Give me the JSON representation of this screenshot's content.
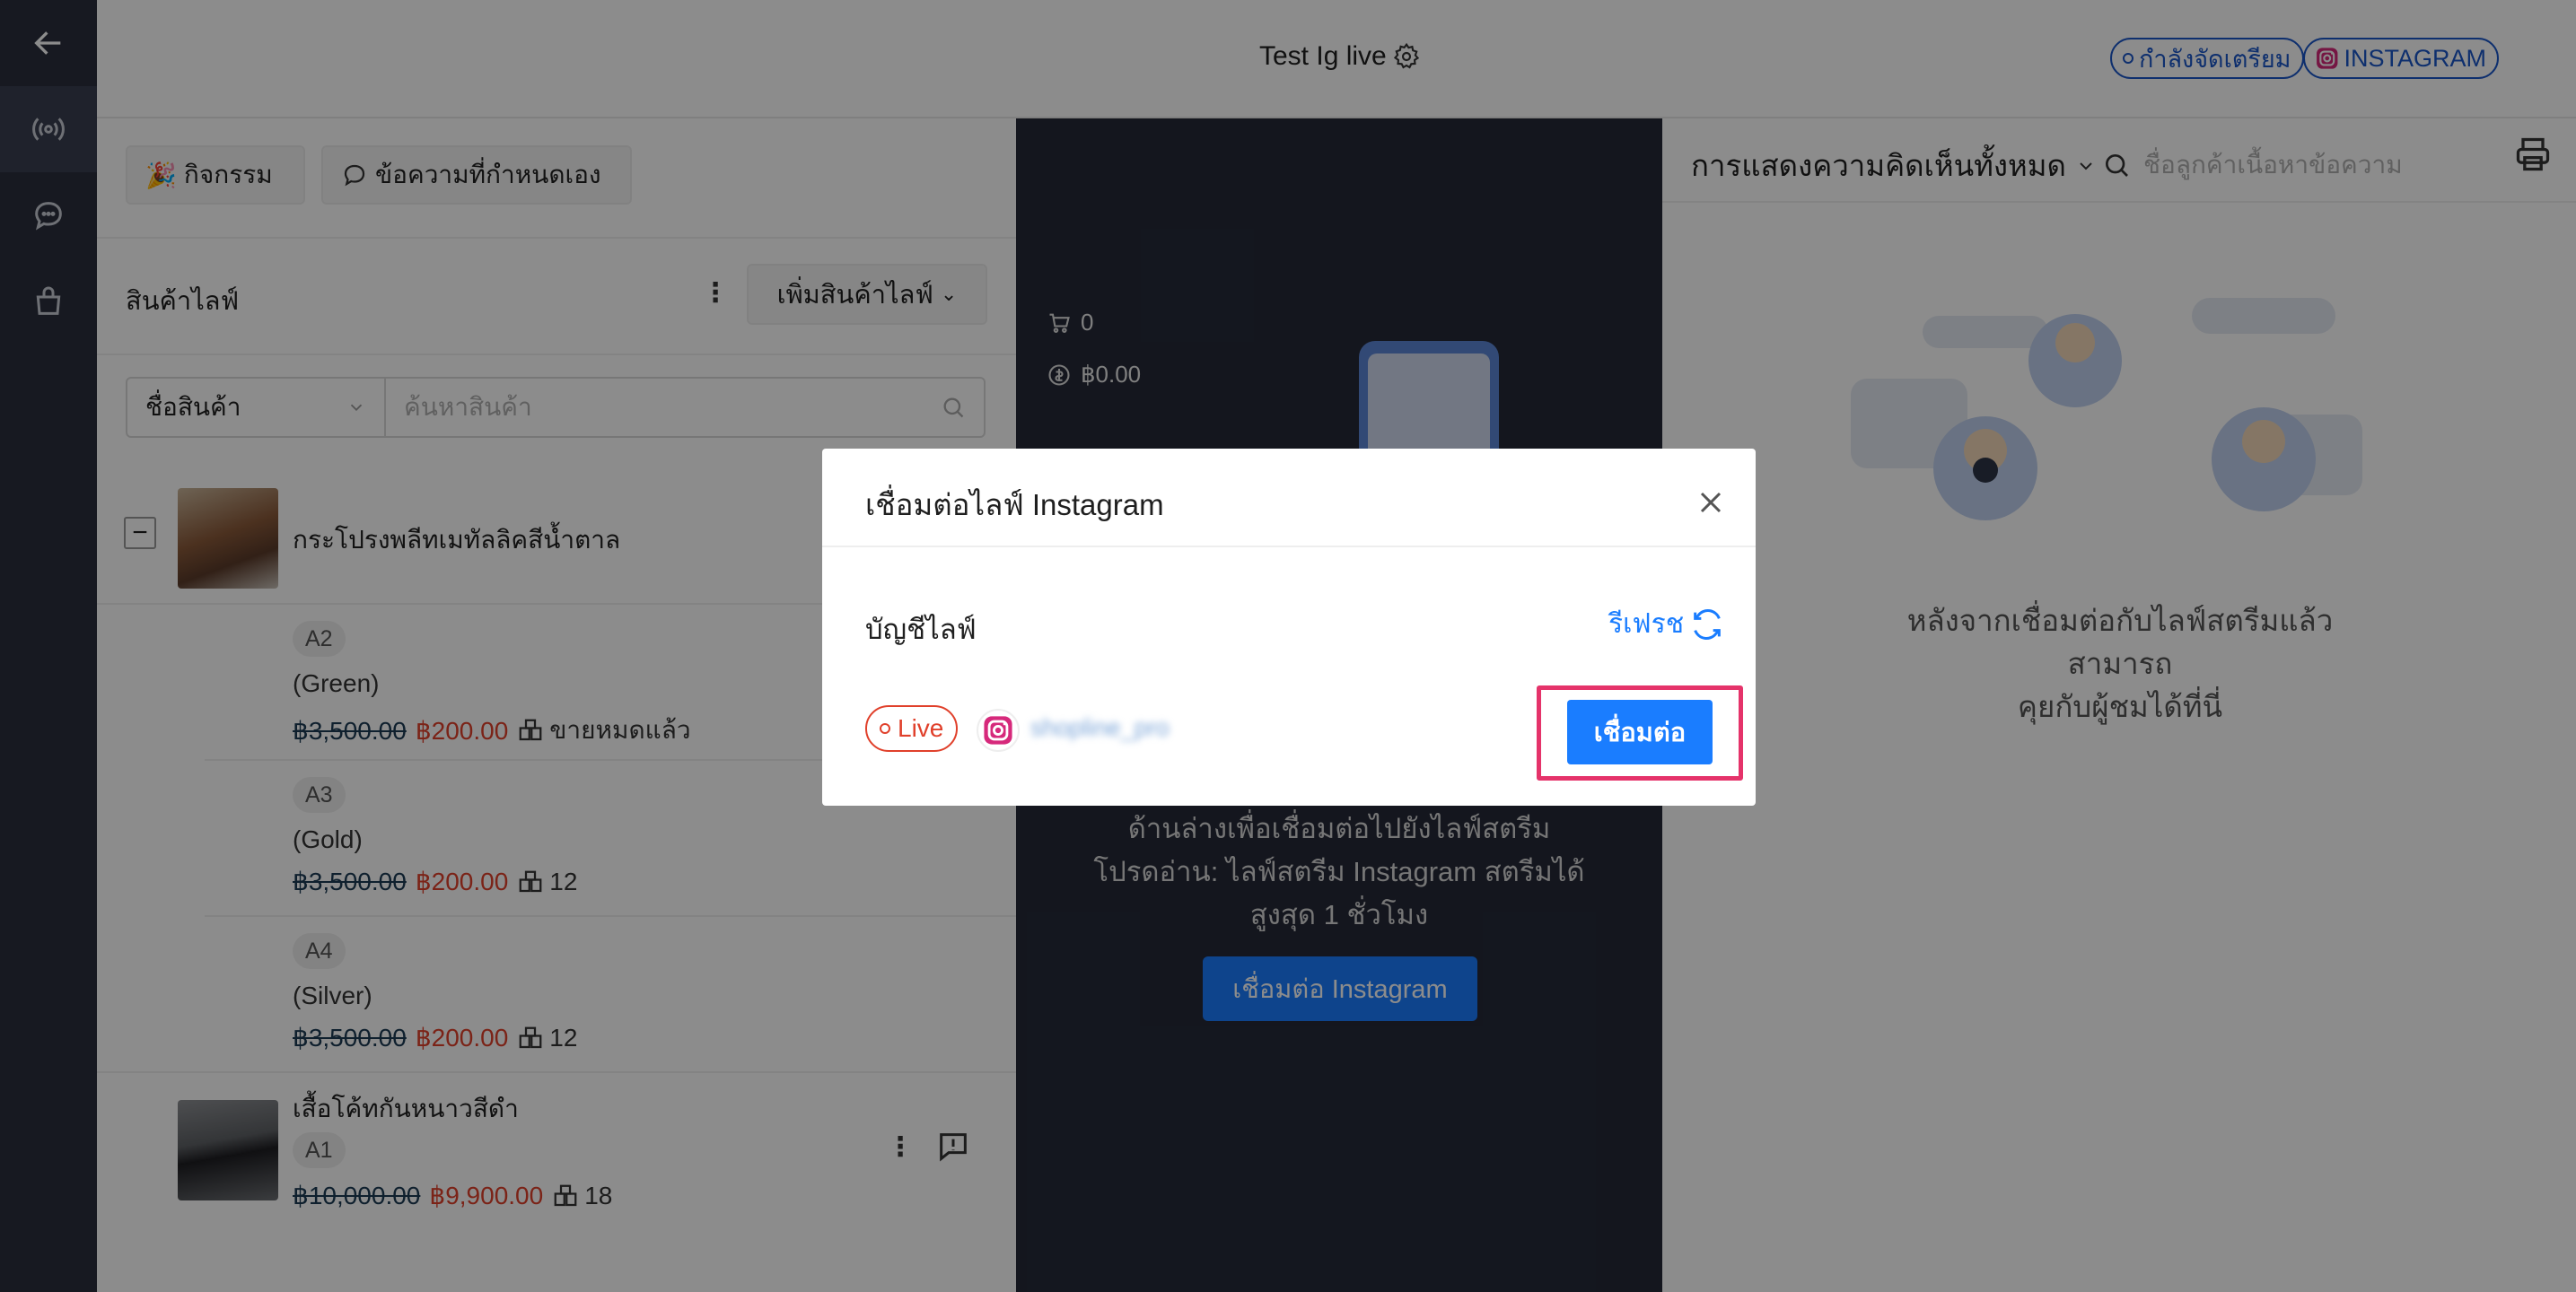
{
  "header": {
    "title": "Test Ig live",
    "status_badge": "กำลังจัดเตรียม",
    "platform_badge": "INSTAGRAM"
  },
  "left_panel": {
    "tabs": [
      "กิจกรรม",
      "ข้อความที่กำหนดเอง"
    ],
    "section_title": "สินค้าไลฟ์",
    "add_button": "เพิ่มสินค้าไลฟ์",
    "search": {
      "select_value": "ชื่อสินค้า",
      "placeholder": "ค้นหาสินค้า"
    },
    "products": [
      {
        "name": "กระโปรงพลีทเมทัลลิคสีน้ำตาล",
        "variants": [
          {
            "sku": "A2",
            "option": "(Green)",
            "old_price": "฿3,500.00",
            "price": "฿200.00",
            "stock": "ขายหมดแล้ว"
          },
          {
            "sku": "A3",
            "option": "(Gold)",
            "old_price": "฿3,500.00",
            "price": "฿200.00",
            "stock": "12"
          },
          {
            "sku": "A4",
            "option": "(Silver)",
            "old_price": "฿3,500.00",
            "price": "฿200.00",
            "stock": "12"
          }
        ]
      },
      {
        "name": "เสื้อโค้ทกันหนาวสีดำ",
        "sku": "A1",
        "old_price": "฿10,000.00",
        "price": "฿9,900.00",
        "stock": "18"
      }
    ]
  },
  "live_panel": {
    "cart_count": "0",
    "revenue": "฿0.00",
    "instruction_line": "ด้านล่างเพื่อเชื่อมต่อไปยังไลฟ์สตรีม",
    "note_line1": "โปรดอ่าน: ไลฟ์สตรีม Instagram สตรีมได้",
    "note_line2": "สูงสุด 1 ชั่วโมง",
    "connect_button": "เชื่อมต่อ Instagram"
  },
  "right_panel": {
    "filter_label": "การแสดงความคิดเห็นทั้งหมด",
    "search_placeholder": "ชื่อลูกค้าเนื้อหาข้อความ",
    "empty_line1": "หลังจากเชื่อมต่อกับไลฟ์สตรีมแล้ว สามารถ",
    "empty_line2": "คุยกับผู้ชมได้ที่นี่"
  },
  "modal": {
    "title": "เชื่อมต่อไลฟ์ Instagram",
    "account_label": "บัญชีไลฟ์",
    "refresh_label": "รีเฟรช",
    "live_pill": "Live",
    "account_name": "shopline_pro",
    "connect_button": "เชื่อมต่อ"
  },
  "colors": {
    "primary": "#1a7dff",
    "price_red": "#e0402b",
    "highlight": "#e5336a",
    "nav_bg": "#2b2f3d",
    "live_bg": "#252938"
  }
}
